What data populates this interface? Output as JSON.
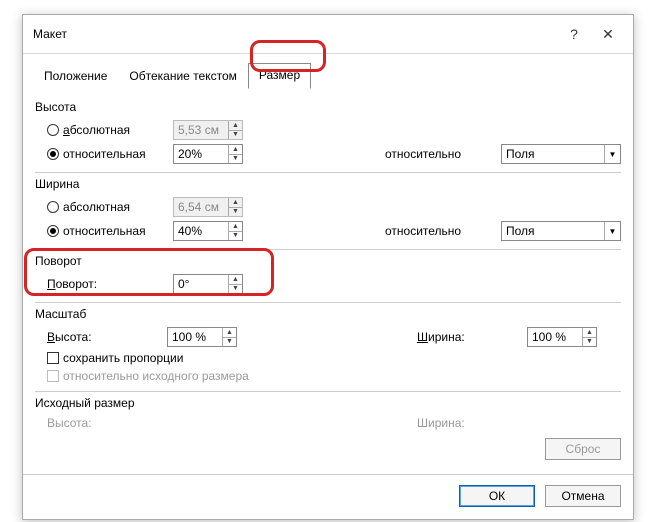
{
  "title": "Макет",
  "tabs": {
    "position": "Положение",
    "wrap": "Обтекание текстом",
    "size": "Размер"
  },
  "groups": {
    "height": "Высота",
    "width": "Ширина",
    "rotation": "Поворот",
    "scale": "Масштаб",
    "origsize": "Исходный размер"
  },
  "labels": {
    "absolute": "бсолютная",
    "absolute_prefix": "а",
    "relative": "относительная",
    "relative_to": "относительно",
    "rotation": "Поворот:",
    "rotation_prefix": "П",
    "scale_height": "ысота:",
    "scale_height_prefix": "В",
    "scale_width": "ирина:",
    "scale_width_prefix": "Ш",
    "lock_ratio": "сохранить пропорции",
    "relative_orig": "относительно исходного размера",
    "orig_height": "Высота:",
    "orig_width": "Ширина:"
  },
  "values": {
    "h_abs": "5,53 см",
    "h_rel": "20%",
    "h_relto": "Поля",
    "w_abs": "6,54 см",
    "w_rel": "40%",
    "w_relto": "Поля",
    "rotation": "0°",
    "scale_h": "100 %",
    "scale_w": "100 %"
  },
  "buttons": {
    "reset": "Сброс",
    "ok": "ОК",
    "cancel": "Отмена"
  }
}
